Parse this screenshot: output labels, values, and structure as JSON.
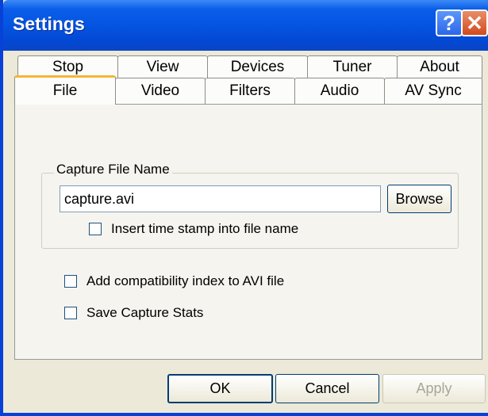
{
  "window": {
    "title": "Settings",
    "help_glyph": "?",
    "close_glyph": "✕"
  },
  "tabs": {
    "row1": [
      "Stop",
      "View",
      "Devices",
      "Tuner",
      "About"
    ],
    "row2": [
      "File",
      "Video",
      "Filters",
      "Audio",
      "AV Sync"
    ],
    "active": "File"
  },
  "capture_group": {
    "legend": "Capture File Name",
    "file_name_value": "capture.avi",
    "browse_label": "Browse",
    "timestamp_label": "Insert time stamp into file name",
    "timestamp_checked": false
  },
  "options": {
    "compat_index_label": "Add compatibility index to AVI file",
    "compat_index_checked": false,
    "save_stats_label": "Save Capture Stats",
    "save_stats_checked": false
  },
  "buttons": {
    "ok_label": "OK",
    "cancel_label": "Cancel",
    "apply_label": "Apply"
  },
  "colors": {
    "title_bar": "#0455e2",
    "close_button": "#d24a1e",
    "active_tab_accent": "#f5b537",
    "dialog_bg": "#ece9d8"
  }
}
